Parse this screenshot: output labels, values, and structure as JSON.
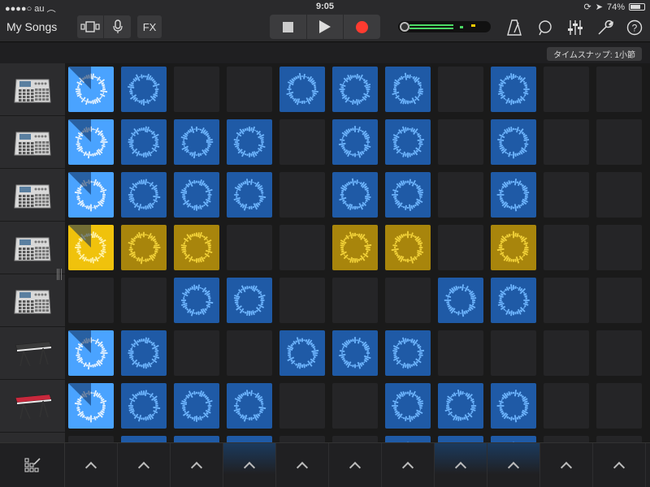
{
  "status": {
    "carrier": "au",
    "time": "9:05",
    "battery": "74%",
    "battery_level": 0.74
  },
  "toolbar": {
    "my_songs": "My Songs",
    "fx": "FX",
    "meter_level": 0.6,
    "colors": {
      "accent_green": "#4cd964",
      "record": "#ff3b30",
      "peak_yellow": "#ffcc00"
    }
  },
  "time_snap": "タイムスナップ: 1小節",
  "tracks": [
    {
      "type": "drum-machine"
    },
    {
      "type": "drum-machine"
    },
    {
      "type": "drum-machine"
    },
    {
      "type": "drum-machine"
    },
    {
      "type": "drum-machine"
    },
    {
      "type": "keyboard-dark"
    },
    {
      "type": "keyboard-red"
    }
  ],
  "grid": {
    "colors": {
      "blue": "#1f5aa6",
      "blue_active": "#4aa3ff",
      "yellow": "#a8850c",
      "yellow_active": "#f0c20c",
      "empty": "#252527"
    },
    "rows": [
      [
        "ba",
        "b",
        "e",
        "e",
        "b",
        "b",
        "b",
        "e",
        "b",
        "e",
        "e"
      ],
      [
        "ba",
        "b",
        "b",
        "b",
        "e",
        "b",
        "b",
        "e",
        "b",
        "e",
        "e"
      ],
      [
        "ba",
        "b",
        "b",
        "b",
        "e",
        "b",
        "b",
        "e",
        "b",
        "e",
        "e"
      ],
      [
        "ya",
        "y",
        "y",
        "e",
        "e",
        "y",
        "y",
        "e",
        "y",
        "e",
        "e"
      ],
      [
        "e",
        "e",
        "b",
        "b",
        "e",
        "e",
        "e",
        "b",
        "b",
        "e",
        "e"
      ],
      [
        "ba",
        "b",
        "e",
        "e",
        "b",
        "b",
        "b",
        "e",
        "e",
        "e",
        "e"
      ],
      [
        "ba",
        "b",
        "b",
        "b",
        "e",
        "e",
        "b",
        "b",
        "b",
        "e",
        "e"
      ],
      [
        "e",
        "b",
        "b",
        "b",
        "e",
        "e",
        "b",
        "b",
        "b",
        "e",
        "e"
      ]
    ]
  },
  "bottom": {
    "columns": 11,
    "lit_columns": [
      3,
      7,
      8
    ]
  }
}
